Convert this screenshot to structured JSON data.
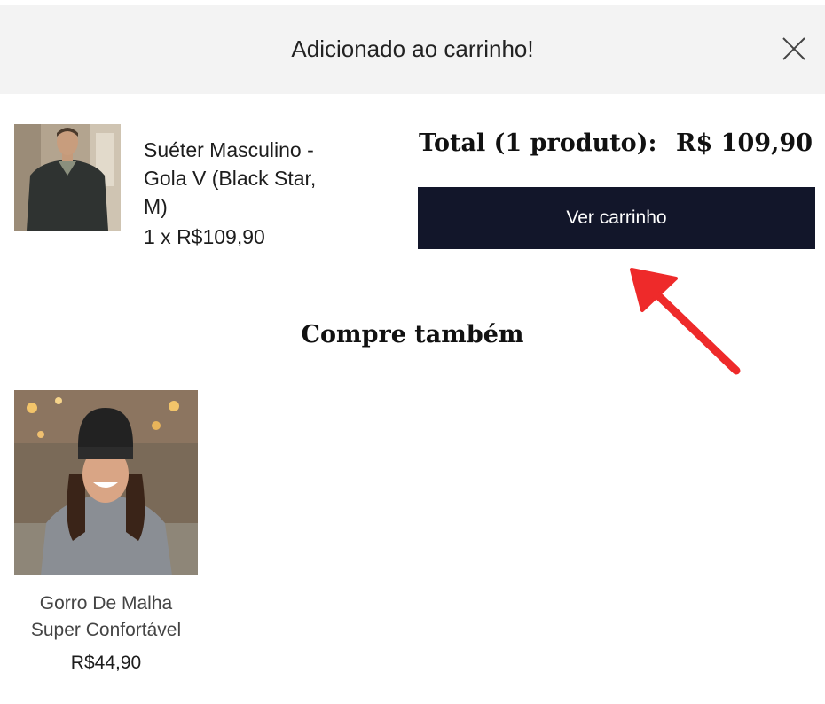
{
  "header": {
    "title": "Adicionado ao carrinho!",
    "close_icon": "close-icon"
  },
  "cart_item": {
    "name": "Suéter Masculino - Gola V (Black Star, M)",
    "quantity_price": "1 x R$109,90",
    "image_icon": "sweater-photo"
  },
  "summary": {
    "total_label": "Total (1 produto):",
    "total_value": "R$ 109,90",
    "view_cart_label": "Ver carrinho"
  },
  "annotation": {
    "arrow_color": "#ee2a2a"
  },
  "recommendations": {
    "title": "Compre também",
    "items": [
      {
        "name": "Gorro De Malha Super Confortável",
        "price": "R$44,90",
        "image_icon": "beanie-photo"
      }
    ]
  },
  "colors": {
    "header_bg": "#f3f3f3",
    "button_bg": "#12162a",
    "button_text": "#ffffff"
  }
}
